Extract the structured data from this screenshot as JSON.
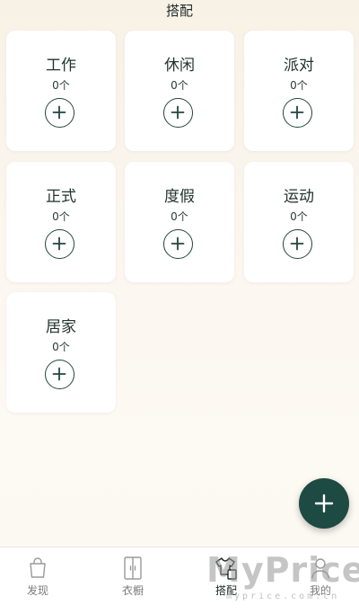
{
  "header": {
    "title": "搭配"
  },
  "categories": [
    {
      "name": "工作",
      "count": "0个"
    },
    {
      "name": "休闲",
      "count": "0个"
    },
    {
      "name": "派对",
      "count": "0个"
    },
    {
      "name": "正式",
      "count": "0个"
    },
    {
      "name": "度假",
      "count": "0个"
    },
    {
      "name": "运动",
      "count": "0个"
    },
    {
      "name": "居家",
      "count": "0个"
    }
  ],
  "fab": {
    "icon": "plus-icon"
  },
  "tabbar": {
    "items": [
      {
        "label": "发现",
        "icon": "bag-icon",
        "active": false
      },
      {
        "label": "衣橱",
        "icon": "wardrobe-icon",
        "active": false
      },
      {
        "label": "搭配",
        "icon": "outfit-icon",
        "active": true
      },
      {
        "label": "我的",
        "icon": "user-icon",
        "active": false
      }
    ]
  },
  "watermark": {
    "brand": "MyPrice",
    "domain": "myprice.com.cn"
  },
  "colors": {
    "accent": "#1d4a42",
    "card_bg": "#ffffff",
    "text": "#23342f"
  }
}
